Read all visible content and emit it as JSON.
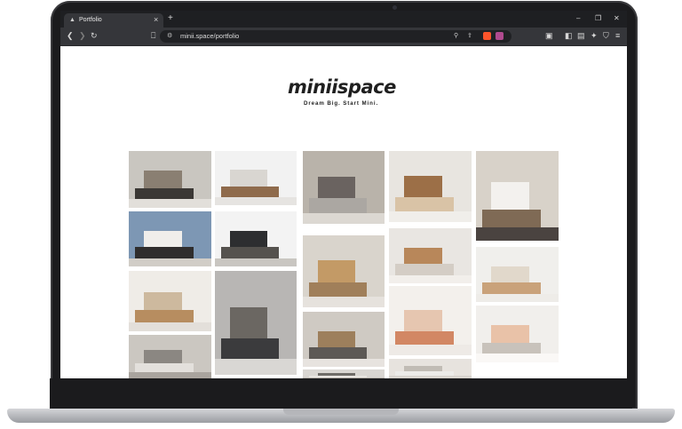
{
  "browser": {
    "tab_title": "Portfolio",
    "tab_close": "×",
    "new_tab": "+",
    "favicon": "minii-logo-icon",
    "url": "minii.space/portfolio",
    "controls": {
      "minimize": "–",
      "maximize": "❐",
      "close": "✕"
    }
  },
  "toolbar_icons": {
    "back": "back-arrow-icon",
    "forward": "forward-arrow-icon",
    "reload": "reload-icon",
    "bookmark": "bookmark-icon",
    "zoom": "zoom-icon",
    "share": "share-icon",
    "brave_shields": "brave-shields-icon",
    "brave_rewards": "brave-rewards-icon",
    "wallet": "wallet-icon",
    "sidebar": "sidebar-icon",
    "tabs": "tab-manager-icon",
    "leo": "ai-assistant-icon",
    "vpn": "vpn-shield-icon",
    "menu": "menu-icon"
  },
  "site": {
    "logo_text": "miniispace",
    "tagline": "Dream Big. Start Mini."
  },
  "colors": {
    "browser_dark": "#1e1f22",
    "toolbar": "#35363a",
    "brave_orange": "#fb542b"
  },
  "gallery_items": [
    {
      "name": "photo-tile-1",
      "c": [
        "#c9c6c0",
        "#8a7f72",
        "#3b3835",
        "#e2dfda"
      ]
    },
    {
      "name": "photo-tile-2",
      "c": [
        "#f2f2f2",
        "#d9d6d1",
        "#8f6b4c",
        "#e6e4e1"
      ]
    },
    {
      "name": "photo-tile-3",
      "c": [
        "#b9b3aa",
        "#6a6360",
        "#aba7a2",
        "#dcd8d2"
      ]
    },
    {
      "name": "photo-tile-4",
      "c": [
        "#e8e5e0",
        "#9c6f47",
        "#d9c3a6",
        "#f0eeea"
      ]
    },
    {
      "name": "photo-tile-5",
      "c": [
        "#d8d2c9",
        "#f3f1ee",
        "#7f6a55",
        "#4a4340"
      ]
    },
    {
      "name": "photo-tile-6",
      "c": [
        "#7d97b4",
        "#f0eeeb",
        "#2f2d2d",
        "#d1cdc7"
      ]
    },
    {
      "name": "photo-tile-7",
      "c": [
        "#f3f3f3",
        "#2d2e30",
        "#55524e",
        "#c9c6c1"
      ]
    },
    {
      "name": "photo-tile-8",
      "c": [
        "#d9d4cc",
        "#c39a66",
        "#a07f5a",
        "#e6e2dd"
      ]
    },
    {
      "name": "photo-tile-9",
      "c": [
        "#e9e6e2",
        "#b8875a",
        "#d4cdc5",
        "#f2efeb"
      ]
    },
    {
      "name": "photo-tile-10",
      "c": [
        "#f0efec",
        "#e1d8cb",
        "#c9a27a",
        "#eeece8"
      ]
    },
    {
      "name": "photo-tile-11",
      "c": [
        "#efece7",
        "#cdb99e",
        "#b78d60",
        "#e3dfda"
      ]
    },
    {
      "name": "photo-tile-12",
      "c": [
        "#b8b6b4",
        "#6b6762",
        "#3b3b3d",
        "#d9d7d4"
      ]
    },
    {
      "name": "photo-tile-13",
      "c": [
        "#cfcac3",
        "#9d7f5c",
        "#5d5955",
        "#e7e3df"
      ]
    },
    {
      "name": "photo-tile-14",
      "c": [
        "#f3f0ec",
        "#e6c6b0",
        "#d28764",
        "#eeeae6"
      ]
    },
    {
      "name": "photo-tile-15",
      "c": [
        "#f1efec",
        "#e9c2a8",
        "#c8c2bb",
        "#faf8f6"
      ]
    },
    {
      "name": "photo-tile-16",
      "c": [
        "#cbc7c1",
        "#8b8782",
        "#e3e0dc",
        "#a9a49e"
      ]
    },
    {
      "name": "photo-tile-17",
      "c": [
        "#d9d6d2",
        "#6f6c68",
        "#e9e6e2",
        "#bfbab4"
      ]
    },
    {
      "name": "photo-tile-18",
      "c": [
        "#e7e3de",
        "#c1bcb5",
        "#ecebe8",
        "#d9d5cf"
      ]
    }
  ]
}
